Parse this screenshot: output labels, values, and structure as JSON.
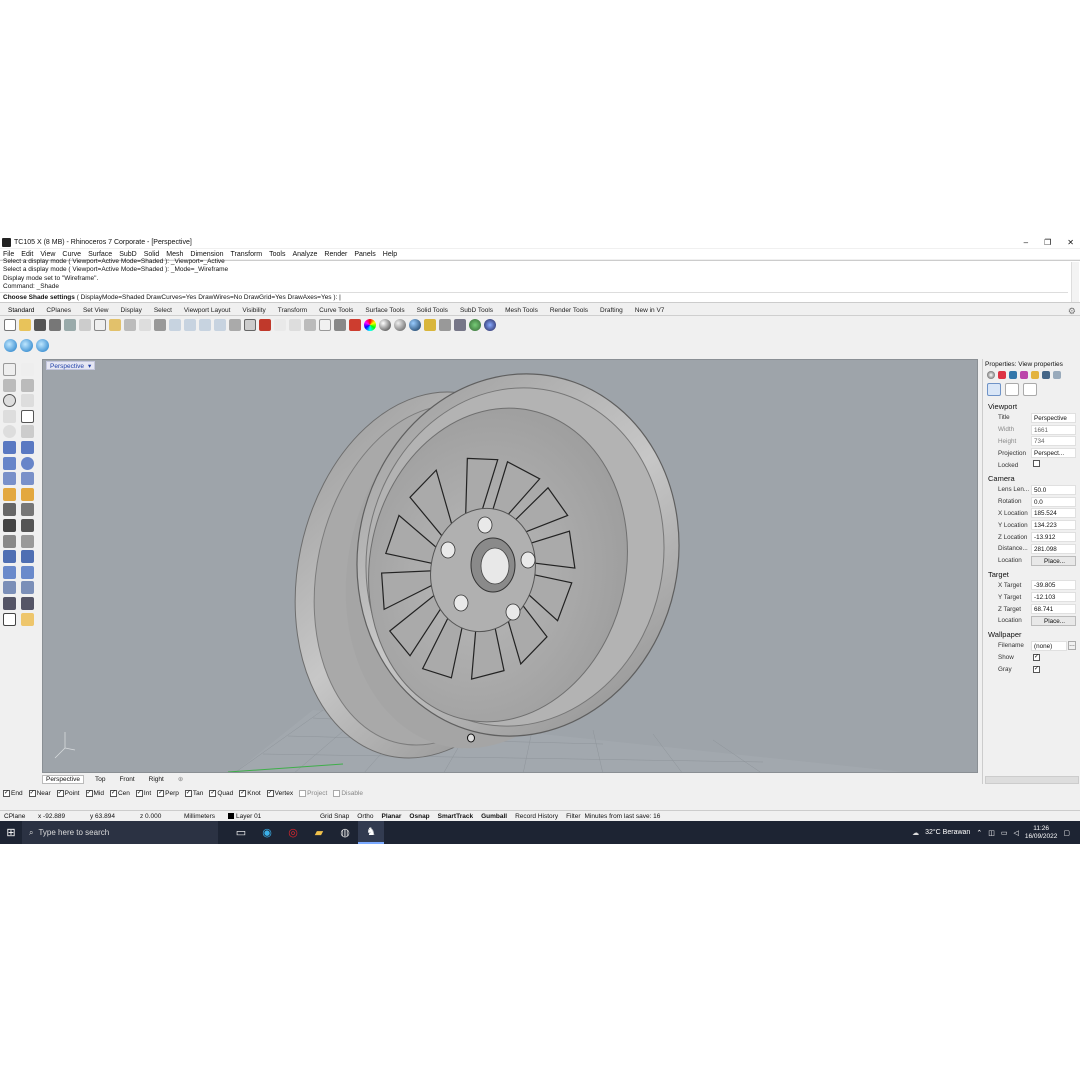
{
  "window": {
    "title": "TC105 X (8 MB) - Rhinoceros 7 Corporate - [Perspective]"
  },
  "menu": [
    "File",
    "Edit",
    "View",
    "Curve",
    "Surface",
    "SubD",
    "Solid",
    "Mesh",
    "Dimension",
    "Transform",
    "Tools",
    "Analyze",
    "Render",
    "Panels",
    "Help"
  ],
  "command_history": [
    "Select a display mode ( Viewport=Active  Mode=Shaded ): _Viewport=_Active",
    "Select a display mode ( Viewport=Active  Mode=Shaded ): _Mode=_Wireframe",
    "Display mode set to \"Wireframe\".",
    "Command: _Shade"
  ],
  "command_prompt": {
    "label": "Choose Shade settings",
    "options": "( DisplayMode=Shaded  DrawCurves=Yes  DrawWires=No  DrawGrid=Yes  DrawAxes=Yes ): |"
  },
  "toolbar_tabs": [
    "Standard",
    "CPlanes",
    "Set View",
    "Display",
    "Select",
    "Viewport Layout",
    "Visibility",
    "Transform",
    "Curve Tools",
    "Surface Tools",
    "Solid Tools",
    "SubD Tools",
    "Mesh Tools",
    "Render Tools",
    "Drafting",
    "New in V7"
  ],
  "viewport": {
    "label": "Perspective",
    "dropdown_glyph": "▾"
  },
  "viewport_tabs": [
    "Perspective",
    "Top",
    "Front",
    "Right",
    "⊕"
  ],
  "osnaps": [
    {
      "label": "End",
      "checked": true
    },
    {
      "label": "Near",
      "checked": true
    },
    {
      "label": "Point",
      "checked": true
    },
    {
      "label": "Mid",
      "checked": true
    },
    {
      "label": "Cen",
      "checked": true
    },
    {
      "label": "Int",
      "checked": true
    },
    {
      "label": "Perp",
      "checked": true
    },
    {
      "label": "Tan",
      "checked": true
    },
    {
      "label": "Quad",
      "checked": true
    },
    {
      "label": "Knot",
      "checked": true
    },
    {
      "label": "Vertex",
      "checked": true
    },
    {
      "label": "Project",
      "checked": false
    },
    {
      "label": "Disable",
      "checked": false
    }
  ],
  "statusbar": {
    "cplane": "CPlane",
    "x": "x -92.889",
    "y": "y 63.894",
    "z": "z 0.000",
    "units": "Millimeters",
    "layer": "Layer 01",
    "toggles": [
      {
        "label": "Grid Snap",
        "bold": false
      },
      {
        "label": "Ortho",
        "bold": false
      },
      {
        "label": "Planar",
        "bold": true
      },
      {
        "label": "Osnap",
        "bold": true
      },
      {
        "label": "SmartTrack",
        "bold": true
      },
      {
        "label": "Gumball",
        "bold": true
      },
      {
        "label": "Record History",
        "bold": false
      },
      {
        "label": "Filter",
        "bold": false
      }
    ],
    "save_info": "Minutes from last save: 16"
  },
  "taskbar": {
    "search_placeholder": "Type here to search",
    "weather": "32°C  Berawan",
    "time": "11:26",
    "date": "16/09/2022"
  },
  "properties": {
    "title": "Properties: View properties",
    "viewport_section": "Viewport",
    "viewport_rows": [
      {
        "label": "Title",
        "value": "Perspective"
      },
      {
        "label": "Width",
        "value": "1661",
        "muted": true
      },
      {
        "label": "Height",
        "value": "734",
        "muted": true
      },
      {
        "label": "Projection",
        "value": "Perspect..."
      },
      {
        "label": "Locked",
        "value": ""
      }
    ],
    "camera_section": "Camera",
    "camera_rows": [
      {
        "label": "Lens Len...",
        "value": "50.0"
      },
      {
        "label": "Rotation",
        "value": "0.0"
      },
      {
        "label": "X Location",
        "value": "185.524"
      },
      {
        "label": "Y Location",
        "value": "134.223"
      },
      {
        "label": "Z Location",
        "value": "-13.912"
      },
      {
        "label": "Distance...",
        "value": "281.098"
      },
      {
        "label": "Location",
        "value": "Place..."
      }
    ],
    "target_section": "Target",
    "target_rows": [
      {
        "label": "X Target",
        "value": "-39.805"
      },
      {
        "label": "Y Target",
        "value": "-12.103"
      },
      {
        "label": "Z Target",
        "value": "68.741"
      },
      {
        "label": "Location",
        "value": "Place..."
      }
    ],
    "wallpaper_section": "Wallpaper",
    "wallpaper_rows": [
      {
        "label": "Filename",
        "value": "(none)"
      },
      {
        "label": "Show",
        "value": ""
      },
      {
        "label": "Gray",
        "value": ""
      }
    ]
  }
}
